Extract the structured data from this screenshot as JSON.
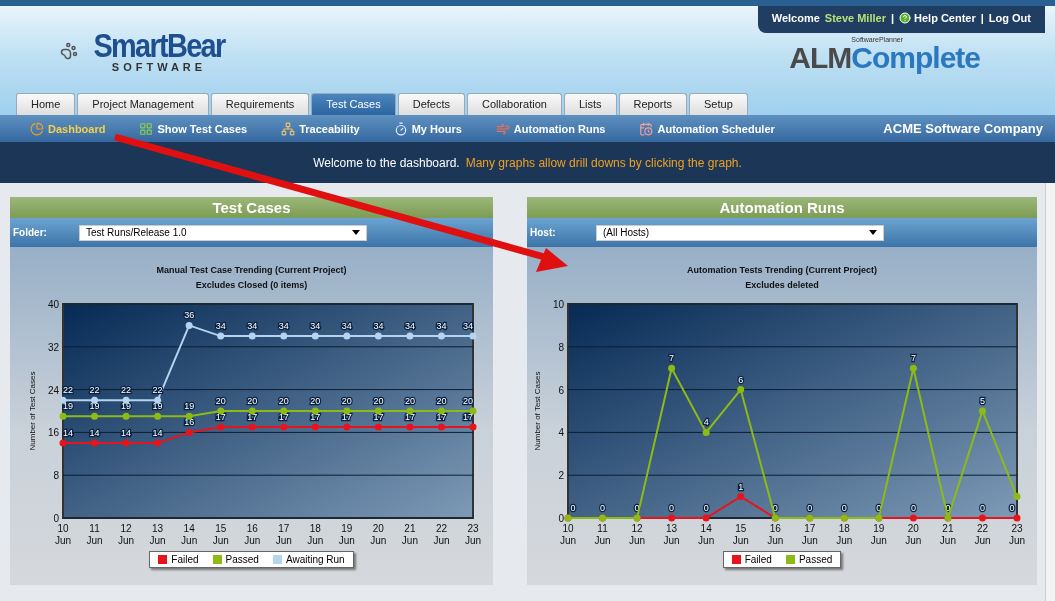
{
  "header": {
    "logo_name": "SmartBear",
    "logo_sub": "SOFTWARE",
    "product_small": "SoftwarePlanner",
    "product_prefix": "ALM",
    "product_main": "Complete"
  },
  "user_bar": {
    "welcome": "Welcome",
    "user": "Steve Miller",
    "separator_1": "|",
    "help": "Help Center",
    "separator_2": "|",
    "logout": "Log Out"
  },
  "tabs": [
    {
      "label": "Home",
      "selected": false
    },
    {
      "label": "Project Management",
      "selected": false
    },
    {
      "label": "Requirements",
      "selected": false
    },
    {
      "label": "Test Cases",
      "selected": true
    },
    {
      "label": "Defects",
      "selected": false
    },
    {
      "label": "Collaboration",
      "selected": false
    },
    {
      "label": "Lists",
      "selected": false
    },
    {
      "label": "Reports",
      "selected": false
    },
    {
      "label": "Setup",
      "selected": false
    }
  ],
  "subnav": {
    "items": [
      {
        "label": "Dashboard",
        "selected": true
      },
      {
        "label": "Show Test Cases",
        "selected": false
      },
      {
        "label": "Traceability",
        "selected": false
      },
      {
        "label": "My Hours",
        "selected": false
      },
      {
        "label": "Automation Runs",
        "selected": false
      },
      {
        "label": "Automation Scheduler",
        "selected": false
      }
    ],
    "company": "ACME Software Company"
  },
  "banner": {
    "welcome": "Welcome to the dashboard.",
    "hint": "Many graphs allow drill downs by clicking the graph."
  },
  "panels": [
    {
      "heading": "Test Cases",
      "filter_label": "Folder:",
      "filter_value": "Test Runs/Release 1.0",
      "chart_subtitle": "Excludes Closed (0 items)",
      "chart_data": {
        "type": "line",
        "title": "Manual Test Case Trending (Current Project)",
        "ylabel": "Number of Test Cases",
        "categories": [
          "10 Jun",
          "11 Jun",
          "12 Jun",
          "13 Jun",
          "14 Jun",
          "15 Jun",
          "16 Jun",
          "17 Jun",
          "18 Jun",
          "19 Jun",
          "20 Jun",
          "21 Jun",
          "22 Jun",
          "23 Jun"
        ],
        "ylim": [
          0,
          40
        ],
        "yticks": [
          0,
          8,
          16,
          24,
          32,
          40
        ],
        "grid": true,
        "legend": "bottom",
        "data_labels": true,
        "series": [
          {
            "name": "Failed",
            "color": "#e8141c",
            "marker": "circle",
            "values": [
              14,
              14,
              14,
              14,
              16,
              17,
              17,
              17,
              17,
              17,
              17,
              17,
              17,
              17
            ]
          },
          {
            "name": "Passed",
            "color": "#8cbc14",
            "marker": "circle",
            "values": [
              19,
              19,
              19,
              19,
              19,
              20,
              20,
              20,
              20,
              20,
              20,
              20,
              20,
              20
            ]
          },
          {
            "name": "Awaiting Run",
            "color": "#b4d4f0",
            "marker": "circle",
            "values": [
              22,
              22,
              22,
              22,
              36,
              34,
              34,
              34,
              34,
              34,
              34,
              34,
              34,
              34
            ]
          }
        ]
      }
    },
    {
      "heading": "Automation Runs",
      "filter_label": "Host:",
      "filter_value": "(All Hosts)",
      "chart_subtitle": "Excludes deleted",
      "chart_data": {
        "type": "line",
        "title": "Automation Tests Trending (Current Project)",
        "ylabel": "Number of Test Cases",
        "categories": [
          "10 Jun",
          "11 Jun",
          "12 Jun",
          "13 Jun",
          "14 Jun",
          "15 Jun",
          "16 Jun",
          "17 Jun",
          "18 Jun",
          "19 Jun",
          "20 Jun",
          "21 Jun",
          "22 Jun",
          "23 Jun"
        ],
        "ylim": [
          0,
          10
        ],
        "yticks": [
          0,
          2,
          4,
          6,
          8,
          10
        ],
        "grid": true,
        "legend": "bottom",
        "value_labels": [
          [
            "0",
            "0",
            "0",
            "0",
            "0",
            "1",
            "0",
            "0",
            "0",
            "0",
            "0",
            "0",
            "0",
            "0"
          ],
          [
            null,
            null,
            null,
            "7",
            "4",
            "6",
            null,
            null,
            null,
            null,
            "7",
            null,
            "5",
            null
          ]
        ],
        "series": [
          {
            "name": "Failed",
            "color": "#e8141c",
            "marker": "circle",
            "values": [
              0,
              0,
              0,
              0,
              0,
              1,
              0,
              0,
              0,
              0,
              0,
              0,
              0,
              0
            ]
          },
          {
            "name": "Passed",
            "color": "#8cbc14",
            "marker": "circle",
            "values": [
              0,
              0,
              0,
              7,
              4,
              6,
              0,
              0,
              0,
              0,
              7,
              0,
              5,
              1
            ]
          }
        ]
      }
    }
  ]
}
